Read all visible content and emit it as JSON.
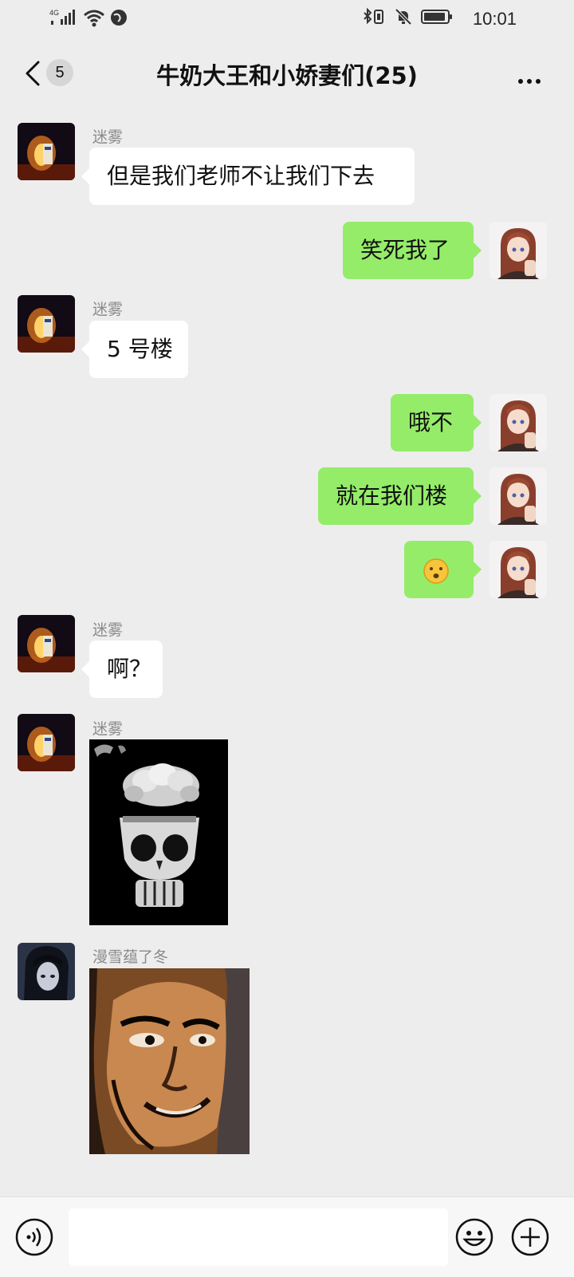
{
  "status": {
    "network": "4G",
    "time": "10:01"
  },
  "nav": {
    "back_count": "5",
    "title": "牛奶大王和小娇妻们(25)"
  },
  "messages": [
    {
      "side": "in",
      "sender": "迷雾",
      "text": "但是我们老师不让我们下去"
    },
    {
      "side": "out",
      "text": "笑死我了"
    },
    {
      "side": "in",
      "sender": "迷雾",
      "text": "5 号楼"
    },
    {
      "side": "out",
      "text": "哦不"
    },
    {
      "side": "out",
      "text": "就在我们楼"
    },
    {
      "side": "out",
      "text": "😦"
    },
    {
      "side": "in",
      "sender": "迷雾",
      "text": "啊？"
    },
    {
      "side": "in",
      "sender": "迷雾",
      "type": "image",
      "image": "skull-popcorn-meme"
    },
    {
      "side": "in",
      "sender": "漫雪蕴了冬",
      "type": "image",
      "image": "grinning-face-meme"
    }
  ],
  "input": {
    "value": "",
    "icons": [
      "voice-icon",
      "emoji-icon",
      "add-icon"
    ]
  },
  "colors": {
    "background": "#ededed",
    "out_bubble": "#95ec69",
    "in_bubble": "#ffffff",
    "sender_name": "#8a8a8a"
  }
}
